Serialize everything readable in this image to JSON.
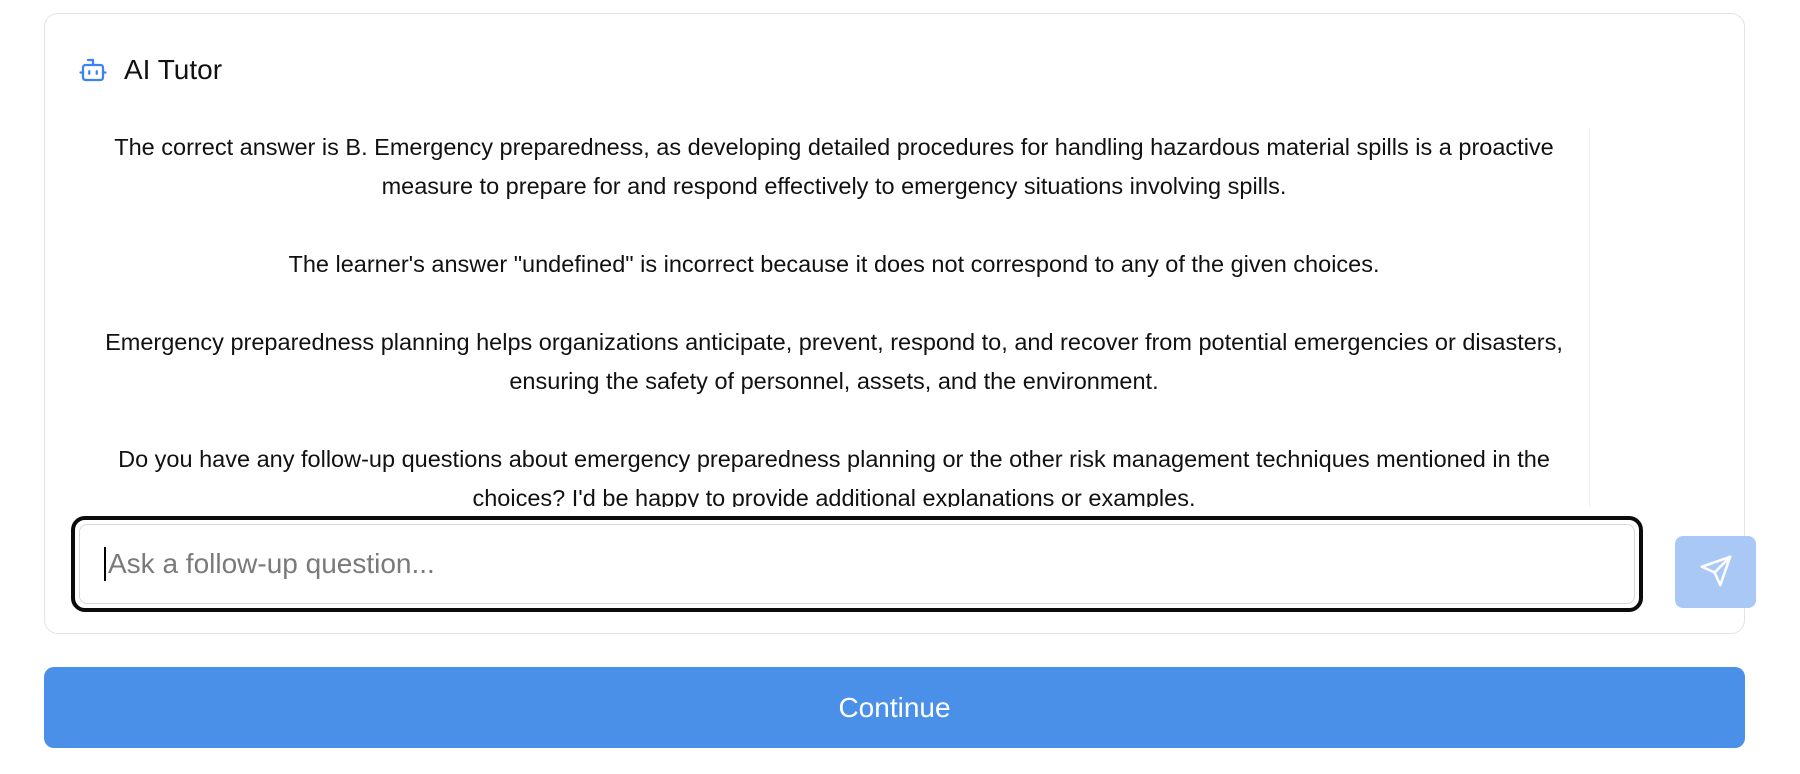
{
  "header": {
    "icon": "bot-icon",
    "title": "AI Tutor"
  },
  "messages": [
    "The correct answer is B. Emergency preparedness, as developing detailed procedures for handling hazardous material spills is a proactive measure to prepare for and respond effectively to emergency situations involving spills.",
    "The learner's answer \"undefined\" is incorrect because it does not correspond to any of the given choices.",
    "Emergency preparedness planning helps organizations anticipate, prevent, respond to, and recover from potential emergencies or disasters, ensuring the safety of personnel, assets, and the environment.",
    "Do you have any follow-up questions about emergency preparedness planning or the other risk management techniques mentioned in the choices? I'd be happy to provide additional explanations or examples."
  ],
  "input": {
    "value": "",
    "placeholder": "Ask a follow-up question..."
  },
  "send_button": {
    "icon": "send-icon"
  },
  "continue_button": {
    "label": "Continue"
  },
  "colors": {
    "accent": "#4a90e9",
    "send_disabled": "#a9c8f5",
    "icon_blue": "#3b82f6"
  }
}
